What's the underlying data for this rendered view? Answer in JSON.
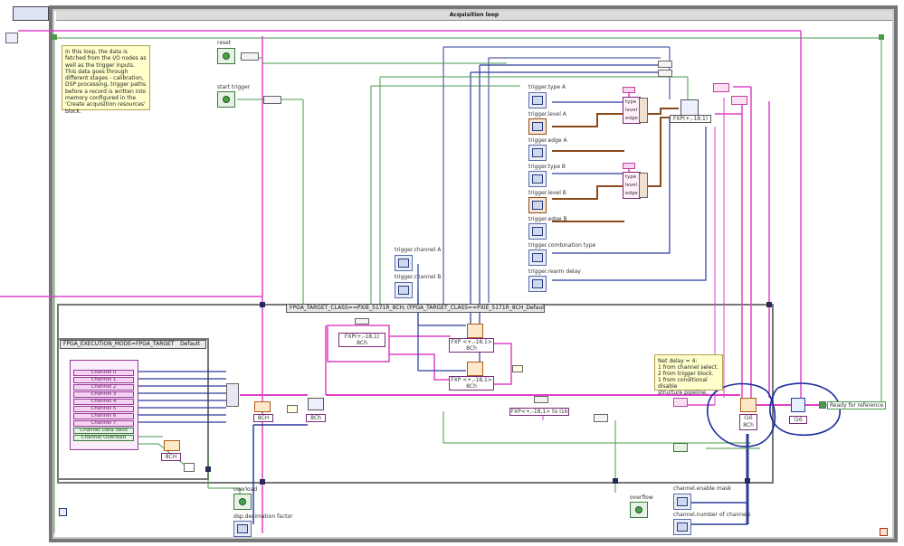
{
  "loop_title": "Acquisition loop",
  "description_comment": "In this loop, the data is fetched from the I/O nodes as well as the trigger inputs. This data goes through different stages - calibration, DSP processing, trigger paths before a record is written into memory configured in the 'Create acquisition resources' block.",
  "delay_comment": [
    "Net delay = 4:",
    "1 from channel select.",
    "2 from trigger block.",
    "1 from conditional disable",
    "structure pipeline."
  ],
  "controls": {
    "reset": "reset",
    "start_trigger": "start trigger",
    "trigger_channel_a": "trigger.channel A",
    "trigger_channel_b": "trigger.channel B",
    "trigger_type_a": "trigger.type A",
    "trigger_level_a": "trigger.level A",
    "trigger_edge_a": "trigger.edge A",
    "trigger_type_b": "trigger.type B",
    "trigger_level_b": "trigger.level B",
    "trigger_edge_b": "trigger.edge B",
    "trigger_combination_type": "trigger.combination type",
    "trigger_rearm_delay": "trigger.rearm delay",
    "overload": "overload",
    "dsp_decimation_factor": "dsp.decimation factor",
    "overflow": "overflow",
    "channel_enable_mask": "channel.enable mask",
    "channel_number_of_channels": "channel.number of channels"
  },
  "case_selectors": {
    "execution_mode": "FPGA_EXECUTION_MODE=FPGA_TARGET",
    "execution_default": "Default",
    "target_class": "FPGA_TARGET_CLASS==PXIE_5171R_8CH, (FPGA_TARGET_CLASS==PXIE_5171R_8CH_Default"
  },
  "channels": [
    "Channel 0",
    "Channel 1",
    "Channel 2",
    "Channel 3",
    "Channel 4",
    "Channel 5",
    "Channel 6",
    "Channel 7",
    "Channel Data Valid",
    "Channel Overload"
  ],
  "type_labels": {
    "fxp_18_1": "FXP(+,-18,1)",
    "fxp_18_1_spaced": "FXP <+,-18,1>",
    "ch8": "8Ch",
    "ch8_upper": "8CH",
    "to_i16": "FXP<+,-18,1> to I16",
    "i16": "I16"
  },
  "bundle_fields": [
    "type",
    "level",
    "edge"
  ],
  "ready_for_reference": "Ready for reference",
  "accent_colors": {
    "pink": "#e040c8",
    "blue": "#2a3a9a",
    "brown": "#8b4a1a",
    "green": "#4a9a4a",
    "annotation": "#1a2a9a"
  }
}
